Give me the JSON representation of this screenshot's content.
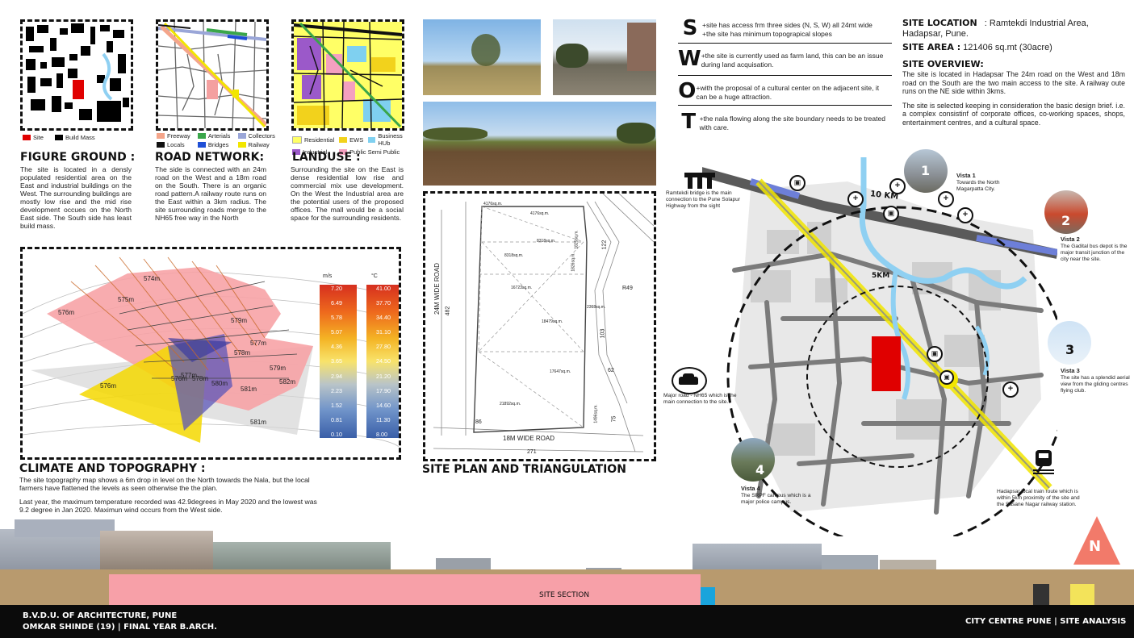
{
  "figure_ground": {
    "title": "FIGURE GROUND :",
    "legend": [
      {
        "label": "Site",
        "color": "#e00000"
      },
      {
        "label": "Build Mass",
        "color": "#000000"
      }
    ],
    "text": "The site is located in a densly populated residential area on the East and industrial buildings on the West. The surrounding buildings are mostly low rise and the mid rise development occues on the North East side. The South side has least build mass."
  },
  "road_network": {
    "title": "ROAD NETWORK:",
    "legend": [
      {
        "label": "Freeway",
        "color": "#f4a58a"
      },
      {
        "label": "Arterials",
        "color": "#3aa64a"
      },
      {
        "label": "Collectors",
        "color": "#9aa6d8"
      },
      {
        "label": "Locals",
        "color": "#111111"
      },
      {
        "label": "Bridges",
        "color": "#1f4fd6"
      },
      {
        "label": "Railway",
        "color": "#f2e600"
      }
    ],
    "text": "The side is connected with an 24m road on the West and a 18m road on the South. There is an organic road pattern.A railway route runs on the East within a 3km radius. The site surrounding roads merge to the NH65 free way in the North"
  },
  "landuse": {
    "title": "LANDUSE :",
    "legend": [
      {
        "label": "Residential",
        "color": "#ffff66"
      },
      {
        "label": "EWS",
        "color": "#f2d21c"
      },
      {
        "label": "Business HUb",
        "color": "#7fd0f0"
      },
      {
        "label": "Industrial",
        "color": "#9b59c9"
      },
      {
        "label": "Public Semi Public",
        "color": "#f4a0c0"
      }
    ],
    "text": "Surrounding the site on the East is dense residential low rise and commercial mix use development. On the West the Industrial area are the potential users of the proposed offices. The mall would be a social space for the surrounding residents."
  },
  "climate": {
    "title": "CLIMATE AND TOPOGRAPHY :",
    "text1": "The site topography map shows a 6m drop in level on the North towards the Nala, but the local farmers have flattened the levels as seen otherwise the the plan.",
    "text2": "Last year, the maximum temperature recorded was 42.9degrees in May 2020 and the lowest was 9.2 degree in Jan 2020. Maximun wind occurs from the West side.",
    "contours": [
      "574m",
      "575m",
      "576m",
      "576m",
      "577m",
      "578m",
      "579m",
      "580m",
      "581m",
      "582m",
      "581m",
      "576m",
      "577m",
      "578m",
      "579m"
    ],
    "wind_unit": "m/s",
    "temp_unit": "°C",
    "wind_scale": [
      "7.20",
      "6.49",
      "5.78",
      "5.07",
      "4.36",
      "3.65",
      "2.94",
      "2.23",
      "1.52",
      "0.81",
      "0.10"
    ],
    "temp_scale": [
      "41.00",
      "37.70",
      "34.40",
      "31.10",
      "27.80",
      "24.50",
      "21.20",
      "17.90",
      "14.60",
      "11.30",
      "8.00"
    ]
  },
  "site_plan": {
    "title": "SITE PLAN AND TRIANGULATION",
    "roads": [
      "24M WIDE ROAD",
      "18M WIDE ROAD"
    ],
    "areas": [
      "4176sq.m.",
      "4176sq.m.",
      "8318sq.m.",
      "8318sq.m.",
      "16723sq.m.",
      "18479sq.m.",
      "17647sq.m.",
      "21892sq.m.",
      "1825sq.m.",
      "1826sq.m.",
      "2368sq.m.",
      "1496sq.m."
    ],
    "dims": [
      "482",
      "271",
      "R49",
      "103",
      "122",
      "62",
      "75",
      "86"
    ]
  },
  "swot": [
    {
      "letter": "S",
      "text": "+site has access frm three sides (N, S, W) all 24mt wide\n+the site has minimum topograpical slopes"
    },
    {
      "letter": "W",
      "text": "+the site is currently used as farm land, this can be an issue during land acquisation."
    },
    {
      "letter": "O",
      "text": "+with the proposal of a cultural center on the adjacent site, it can be a huge attraction."
    },
    {
      "letter": "T",
      "text": "+the nala flowing along the site boundary needs to be treated with care."
    }
  ],
  "site_info": {
    "location_label": "SITE LOCATION",
    "location_value": ": Ramtekdi Industrial Area, Hadapsar, Pune.",
    "area_label": "SITE AREA :",
    "area_value": "121406 sq.mt (30acre)",
    "overview_title": "SITE OVERVIEW:",
    "overview_p1": "The site is located in Hadapsar The 24m road on the West and 18m road on the South are the two main access to the site. A railway oute runs on the NE side within 3kms.",
    "overview_p2": "The site is selected keeping in consideration the basic design brief. i.e. a complex consistinf of corporate offices, co-working spaces, shops, entertainment centres, and a cultural space."
  },
  "map": {
    "radius_10": "10 KM",
    "radius_5": "5KM",
    "bridge_note": "Ramtekdi bridge is the main connection to the Pune Solapur Highway from the sight",
    "road_note": "Major road - NH65 which is the main connection to the site.",
    "train_note": "Hadapsar local train route which is within 5km proximity of the site and the Sasane Nagar railway station.",
    "vistas": [
      {
        "num": "1",
        "title": "Vista 1",
        "text": "Towards the North Magarpatta City."
      },
      {
        "num": "2",
        "title": "Vista 2",
        "text": "The Gadital bus depot is the major transit junction of the city near the site."
      },
      {
        "num": "3",
        "title": "Vista 3",
        "text": "The site has a splendid aerial view from the gliding centres flying club."
      },
      {
        "num": "4",
        "title": "Vista 4",
        "text": "The SRPF campus which is a major police campus."
      }
    ],
    "north": "N"
  },
  "section": {
    "label": "SITE SECTION"
  },
  "footer": {
    "school": "B.V.D.U. OF ARCHITECTURE, PUNE",
    "author": "OMKAR SHINDE (19) | FINAL YEAR B.ARCH.",
    "project": "CITY CENTRE PUNE | SITE ANALYSIS"
  },
  "colors": {
    "site_red": "#e00000",
    "footer_bg": "#0b0b0b",
    "section_pink": "#f7a0a8"
  }
}
